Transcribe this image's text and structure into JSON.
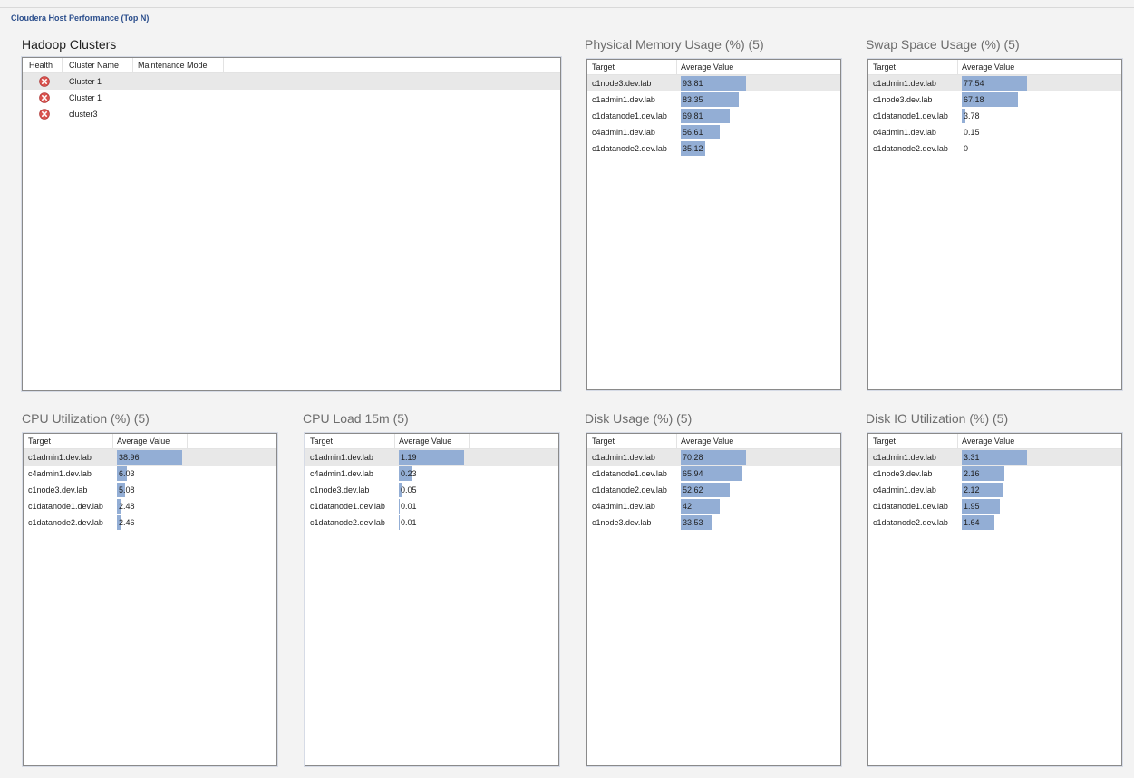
{
  "app": {
    "title": "Cloudera Host Performance (Top N)"
  },
  "colors": {
    "bar": "#93aed5",
    "error": "#d9534f",
    "title_link": "#2b4e8c"
  },
  "clusters": {
    "title": "Hadoop Clusters",
    "columns": [
      "Health",
      "Cluster Name",
      "Maintenance Mode"
    ],
    "rows": [
      {
        "health_icon": "error-icon",
        "name": "Cluster 1",
        "maintenance": ""
      },
      {
        "health_icon": "error-icon",
        "name": "Cluster 1",
        "maintenance": ""
      },
      {
        "health_icon": "error-icon",
        "name": "cluster3",
        "maintenance": ""
      }
    ]
  },
  "widgets": {
    "memory": {
      "title": "Physical Memory Usage (%) (5)",
      "columns": [
        "Target",
        "Average Value"
      ],
      "max": 93.81,
      "rows": [
        {
          "target": "c1node3.dev.lab",
          "value": "93.81"
        },
        {
          "target": "c1admin1.dev.lab",
          "value": "83.35"
        },
        {
          "target": "c1datanode1.dev.lab",
          "value": "69.81"
        },
        {
          "target": "c4admin1.dev.lab",
          "value": "56.61"
        },
        {
          "target": "c1datanode2.dev.lab",
          "value": "35.12"
        }
      ]
    },
    "swap": {
      "title": "Swap Space Usage (%) (5)",
      "columns": [
        "Target",
        "Average Value"
      ],
      "max": 77.54,
      "rows": [
        {
          "target": "c1admin1.dev.lab",
          "value": "77.54"
        },
        {
          "target": "c1node3.dev.lab",
          "value": "67.18"
        },
        {
          "target": "c1datanode1.dev.lab",
          "value": "3.78"
        },
        {
          "target": "c4admin1.dev.lab",
          "value": "0.15"
        },
        {
          "target": "c1datanode2.dev.lab",
          "value": "0"
        }
      ]
    },
    "cpu": {
      "title": "CPU Utilization (%) (5)",
      "columns": [
        "Target",
        "Average Value"
      ],
      "max": 38.96,
      "rows": [
        {
          "target": "c1admin1.dev.lab",
          "value": "38.96"
        },
        {
          "target": "c4admin1.dev.lab",
          "value": "6.03"
        },
        {
          "target": "c1node3.dev.lab",
          "value": "5.08"
        },
        {
          "target": "c1datanode1.dev.lab",
          "value": "2.48"
        },
        {
          "target": "c1datanode2.dev.lab",
          "value": "2.46"
        }
      ]
    },
    "load": {
      "title": "CPU Load 15m (5)",
      "columns": [
        "Target",
        "Average Value"
      ],
      "max": 1.19,
      "rows": [
        {
          "target": "c1admin1.dev.lab",
          "value": "1.19"
        },
        {
          "target": "c4admin1.dev.lab",
          "value": "0.23"
        },
        {
          "target": "c1node3.dev.lab",
          "value": "0.05"
        },
        {
          "target": "c1datanode1.dev.lab",
          "value": "0.01"
        },
        {
          "target": "c1datanode2.dev.lab",
          "value": "0.01"
        }
      ]
    },
    "disk": {
      "title": "Disk Usage (%) (5)",
      "columns": [
        "Target",
        "Average Value"
      ],
      "max": 70.28,
      "rows": [
        {
          "target": "c1admin1.dev.lab",
          "value": "70.28"
        },
        {
          "target": "c1datanode1.dev.lab",
          "value": "65.94"
        },
        {
          "target": "c1datanode2.dev.lab",
          "value": "52.62"
        },
        {
          "target": "c4admin1.dev.lab",
          "value": "42"
        },
        {
          "target": "c1node3.dev.lab",
          "value": "33.53"
        }
      ]
    },
    "diskio": {
      "title": "Disk IO Utilization (%) (5)",
      "columns": [
        "Target",
        "Average Value"
      ],
      "max": 3.31,
      "rows": [
        {
          "target": "c1admin1.dev.lab",
          "value": "3.31"
        },
        {
          "target": "c1node3.dev.lab",
          "value": "2.16"
        },
        {
          "target": "c4admin1.dev.lab",
          "value": "2.12"
        },
        {
          "target": "c1datanode1.dev.lab",
          "value": "1.95"
        },
        {
          "target": "c1datanode2.dev.lab",
          "value": "1.64"
        }
      ]
    }
  }
}
